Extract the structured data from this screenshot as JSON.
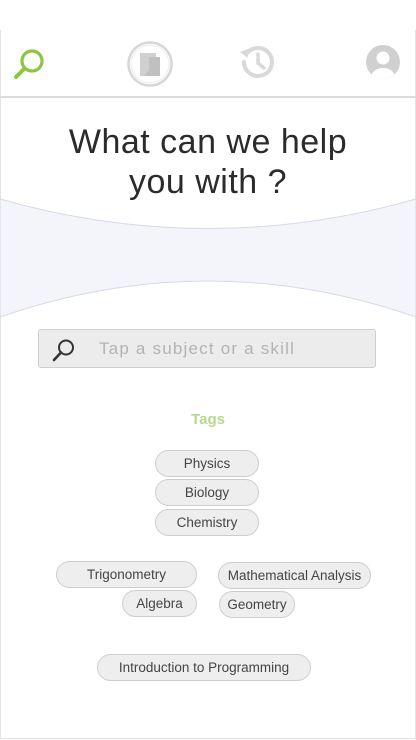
{
  "nav": {
    "search_color": "#8cc63f",
    "inactive_color": "#d7d7d7",
    "icons": [
      "search-icon",
      "book-icon",
      "history-icon",
      "profile-icon"
    ]
  },
  "headline": {
    "line1": "What can we help",
    "line2": "you with ?"
  },
  "search": {
    "placeholder": "Tap a subject or a skill",
    "value": ""
  },
  "tags": {
    "title": "Tags",
    "title_color": "#b5d98a",
    "items": [
      "Physics",
      "Biology",
      "Chemistry",
      "Trigonometry",
      "Mathematical Analysis",
      "Algebra",
      "Geometry",
      "Introduction to Programming"
    ]
  }
}
